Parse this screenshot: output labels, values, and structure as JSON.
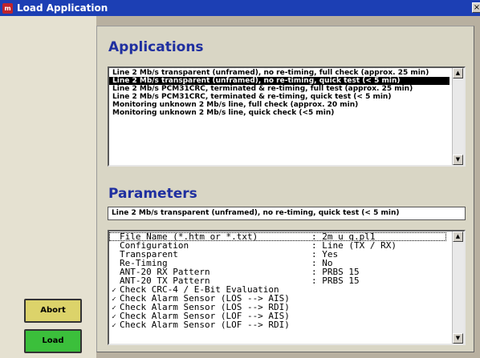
{
  "window": {
    "title": "Load Application",
    "icon": "app-icon",
    "close_label": "×"
  },
  "applications": {
    "heading": "Applications",
    "items": [
      "Line 2 Mb/s transparent (unframed), no re-timing, full check (approx. 25 min)",
      "Line 2 Mb/s transparent (unframed), no re-timing, quick test (< 5 min)",
      "Line 2 Mb/s PCM31CRC, terminated & re-timing, full test (approx. 25 min)",
      "Line 2 Mb/s PCM31CRC, terminated & re-timing, quick test (< 5 min)",
      "Monitoring unknown 2 Mb/s line, full check (approx. 20 min)",
      "Monitoring unknown 2 Mb/s line, quick check (<5 min)"
    ],
    "selected_index": 1
  },
  "parameters": {
    "heading": "Parameters",
    "summary": "Line 2 Mb/s transparent (unframed), no re-timing, quick test (< 5 min)",
    "rows": [
      {
        "label": "File Name (*.htm or *.txt)",
        "value": ": 2m_u_q.pl1",
        "check": ""
      },
      {
        "label": "Configuration",
        "value": ": Line (TX / RX)",
        "check": ""
      },
      {
        "label": "Transparent",
        "value": ": Yes",
        "check": ""
      },
      {
        "label": "Re-Timing",
        "value": ": No",
        "check": ""
      },
      {
        "label": "ANT-20 RX Pattern",
        "value": ": PRBS 15",
        "check": ""
      },
      {
        "label": "ANT-20 TX Pattern",
        "value": ": PRBS 15",
        "check": ""
      },
      {
        "label": "Check CRC-4 / E-Bit Evaluation",
        "value": "",
        "check": "✓"
      },
      {
        "label": "Check Alarm Sensor (LOS --> AIS)",
        "value": "",
        "check": "✓"
      },
      {
        "label": "Check Alarm Sensor (LOS --> RDI)",
        "value": "",
        "check": "✓"
      },
      {
        "label": "Check Alarm Sensor (LOF --> AIS)",
        "value": "",
        "check": "✓"
      },
      {
        "label": "Check Alarm Sensor (LOF --> RDI)",
        "value": "",
        "check": "✓"
      }
    ]
  },
  "buttons": {
    "abort": "Abort",
    "load": "Load"
  },
  "scroll": {
    "up": "▲",
    "down": "▼"
  }
}
